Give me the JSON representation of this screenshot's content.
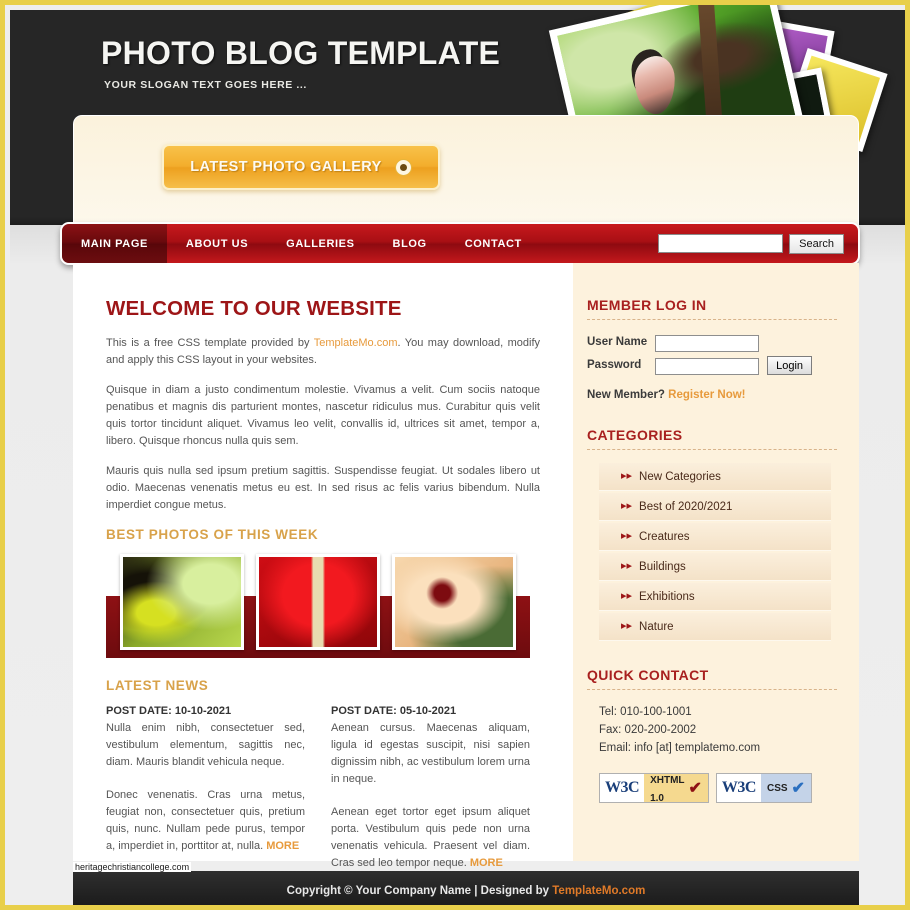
{
  "header": {
    "title": "PHOTO BLOG TEMPLATE",
    "slogan": "YOUR SLOGAN TEXT GOES HERE ..."
  },
  "gallery_button": {
    "label": "LATEST PHOTO GALLERY",
    "icon": "circle-badge-icon"
  },
  "nav": {
    "items": [
      {
        "label": "MAIN PAGE",
        "active": true
      },
      {
        "label": "ABOUT US",
        "active": false
      },
      {
        "label": "GALLERIES",
        "active": false
      },
      {
        "label": "BLOG",
        "active": false
      },
      {
        "label": "CONTACT",
        "active": false
      }
    ],
    "search": {
      "value": "",
      "placeholder": "",
      "button_label": "Search"
    }
  },
  "main": {
    "welcome_heading": "WELCOME TO OUR WEBSITE",
    "intro_before": "This is a free CSS template provided by ",
    "intro_link": "TemplateMo.com",
    "intro_after": ". You may download, modify and apply this CSS layout in your websites.",
    "paragraph_1": "Quisque in diam a justo condimentum molestie. Vivamus a velit. Cum sociis natoque penatibus et magnis dis parturient montes, nascetur ridiculus mus. Curabitur quis velit quis tortor tincidunt aliquet. Vivamus leo velit, convallis id, ultrices sit amet, tempor a, libero. Quisque rhoncus nulla quis sem.",
    "paragraph_2": "Mauris quis nulla sed ipsum pretium sagittis. Suspendisse feugiat. Ut sodales libero ut odio. Maecenas venenatis metus eu est. In sed risus ac felis varius bibendum. Nulla imperdiet congue metus.",
    "best_photos_heading": "BEST PHOTOS OF THIS WEEK",
    "thumbnails": [
      {
        "name": "butterfly-on-leaves"
      },
      {
        "name": "red-anthurium-flower"
      },
      {
        "name": "peach-hibiscus-flower"
      }
    ],
    "latest_news_heading": "LATEST NEWS",
    "news": [
      {
        "date": "POST DATE: 10-10-2021",
        "body": "Nulla enim nibh, consectetuer sed, vestibulum elementum, sagittis nec, diam. Mauris blandit vehicula neque.",
        "more": ""
      },
      {
        "date": "POST DATE: 05-10-2021",
        "body": "Aenean cursus. Maecenas aliquam, ligula id egestas suscipit, nisi sapien dignissim nibh, ac vestibulum lorem urna in neque.",
        "more": ""
      },
      {
        "date": "",
        "body": "Donec venenatis. Cras urna metus, feugiat non, consectetuer quis, pretium quis, nunc. Nullam pede purus, tempor a, imperdiet in, porttitor at, nulla. ",
        "more": "MORE"
      },
      {
        "date": "",
        "body": "Aenean eget tortor eget ipsum aliquet porta. Vestibulum quis pede non urna venenatis vehicula. Praesent vel diam. Cras sed leo tempor neque. ",
        "more": "MORE"
      }
    ]
  },
  "sidebar": {
    "login": {
      "heading": "MEMBER LOG IN",
      "username_label": "User Name",
      "username_value": "",
      "password_label": "Password",
      "password_value": "",
      "login_button": "Login",
      "new_member_text": "New Member? ",
      "register_link": "Register Now!"
    },
    "categories": {
      "heading": "CATEGORIES",
      "arrow": "▸▸",
      "items": [
        {
          "label": "New Categories"
        },
        {
          "label": "Best of 2020/2021"
        },
        {
          "label": "Creatures"
        },
        {
          "label": "Buildings"
        },
        {
          "label": "Exhibitions"
        },
        {
          "label": "Nature"
        }
      ]
    },
    "contact": {
      "heading": "QUICK CONTACT",
      "tel": "Tel: 010-100-1001",
      "fax": "Fax: 020-200-2002",
      "email": "Email: info [at] templatemo.com"
    },
    "badges": [
      {
        "w3c": "W3C",
        "kind_line_1": "XHTML",
        "kind_line_2": "1.0",
        "check": "✔"
      },
      {
        "w3c": "W3C",
        "kind_line_1": "CSS",
        "kind_line_2": "",
        "check": "✔"
      }
    ]
  },
  "footer": {
    "text_before": "Copyright © Your Company Name | Designed by ",
    "link": "TemplateMo.com",
    "watermark": "heritagechristiancollege.com"
  },
  "colors": {
    "frame": "#e8cf4a",
    "header_bg": "#262626",
    "nav_red": "#a80f14",
    "heading_red": "#9d1517",
    "accent_orange": "#e79a3c",
    "sidebar_bg": "#fdf2dd"
  }
}
